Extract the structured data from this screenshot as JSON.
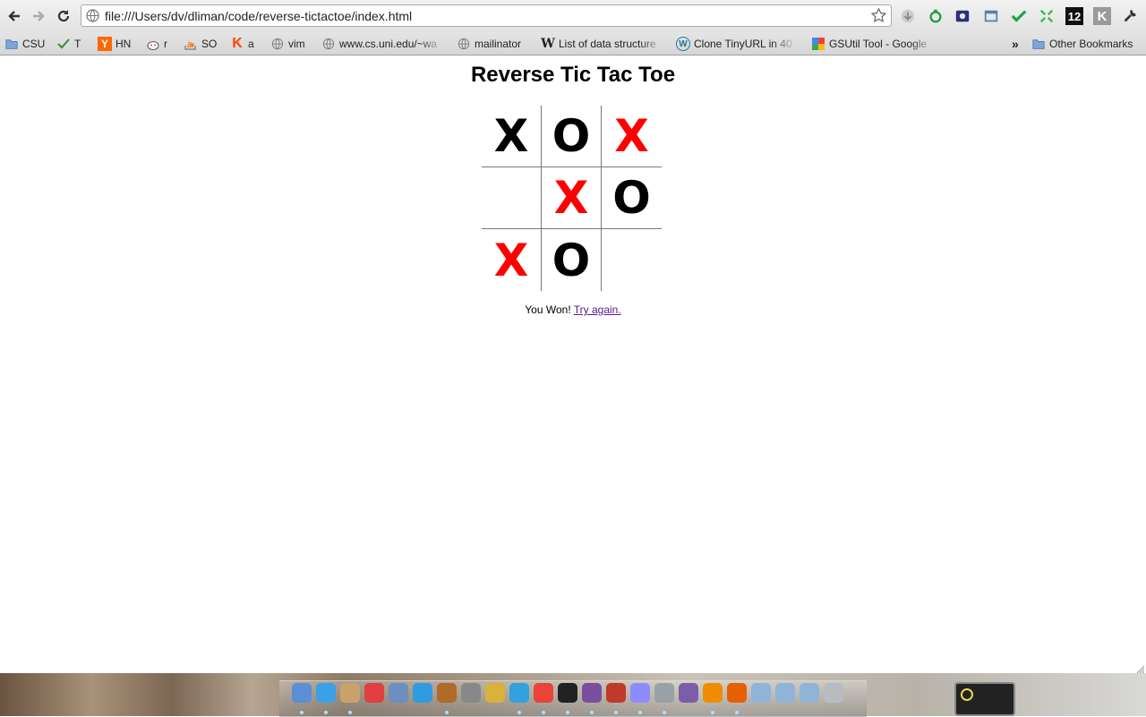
{
  "browser": {
    "url": "file:///Users/dv/dliman/code/reverse-tictactoe/index.html",
    "extensions": {
      "badge_12": "12",
      "k_label": "K"
    }
  },
  "bookmarks": {
    "items": [
      {
        "label": "CSU",
        "icon": "folder-icon"
      },
      {
        "label": "T",
        "icon": "checkmark-icon"
      },
      {
        "label": "HN",
        "icon": "hacker-news-icon",
        "icon_text": "Y"
      },
      {
        "label": "r",
        "icon": "reddit-icon"
      },
      {
        "label": "SO",
        "icon": "stack-overflow-icon"
      },
      {
        "label": "a",
        "icon": "k-logo-icon",
        "icon_text": "K"
      },
      {
        "label": "vim",
        "icon": "globe-icon"
      },
      {
        "label": "www.cs.uni.edu/~wa",
        "icon": "globe-icon"
      },
      {
        "label": "mailinator",
        "icon": "globe-icon"
      },
      {
        "label": "List of data structure",
        "icon": "wikipedia-icon",
        "icon_text": "W"
      },
      {
        "label": "Clone TinyURL in 40",
        "icon": "wordpress-icon",
        "icon_text": "W"
      },
      {
        "label": "GSUtil Tool - Google",
        "icon": "google-icon"
      }
    ],
    "overflow": "»",
    "other": "Other Bookmarks"
  },
  "page": {
    "title": "Reverse Tic Tac Toe",
    "board": [
      [
        {
          "mark": "X",
          "color": "#000000"
        },
        {
          "mark": "O",
          "color": "#000000"
        },
        {
          "mark": "X",
          "color": "#ff0000"
        }
      ],
      [
        {
          "mark": "",
          "color": "#000000"
        },
        {
          "mark": "X",
          "color": "#ff0000"
        },
        {
          "mark": "O",
          "color": "#000000"
        }
      ],
      [
        {
          "mark": "X",
          "color": "#ff0000"
        },
        {
          "mark": "O",
          "color": "#000000"
        },
        {
          "mark": "",
          "color": "#000000"
        }
      ]
    ],
    "status_text": "You Won!",
    "try_again": "Try again."
  },
  "dock": {
    "icons": [
      "finder-icon",
      "safari-icon",
      "preview-icon",
      "calendar-icon",
      "iphoto-icon",
      "itunes-icon",
      "garageband-icon",
      "photo-booth-icon",
      "chrome-canary-icon",
      "twitter-icon",
      "chrome-icon",
      "terminal-icon",
      "emacs-icon",
      "rocket-icon",
      "xcode-icon",
      "app-icon",
      "eclipse-icon",
      "vlc-icon",
      "firefox-icon",
      "applications-folder-icon",
      "documents-folder-icon",
      "downloads-folder-icon",
      "trash-icon"
    ]
  }
}
